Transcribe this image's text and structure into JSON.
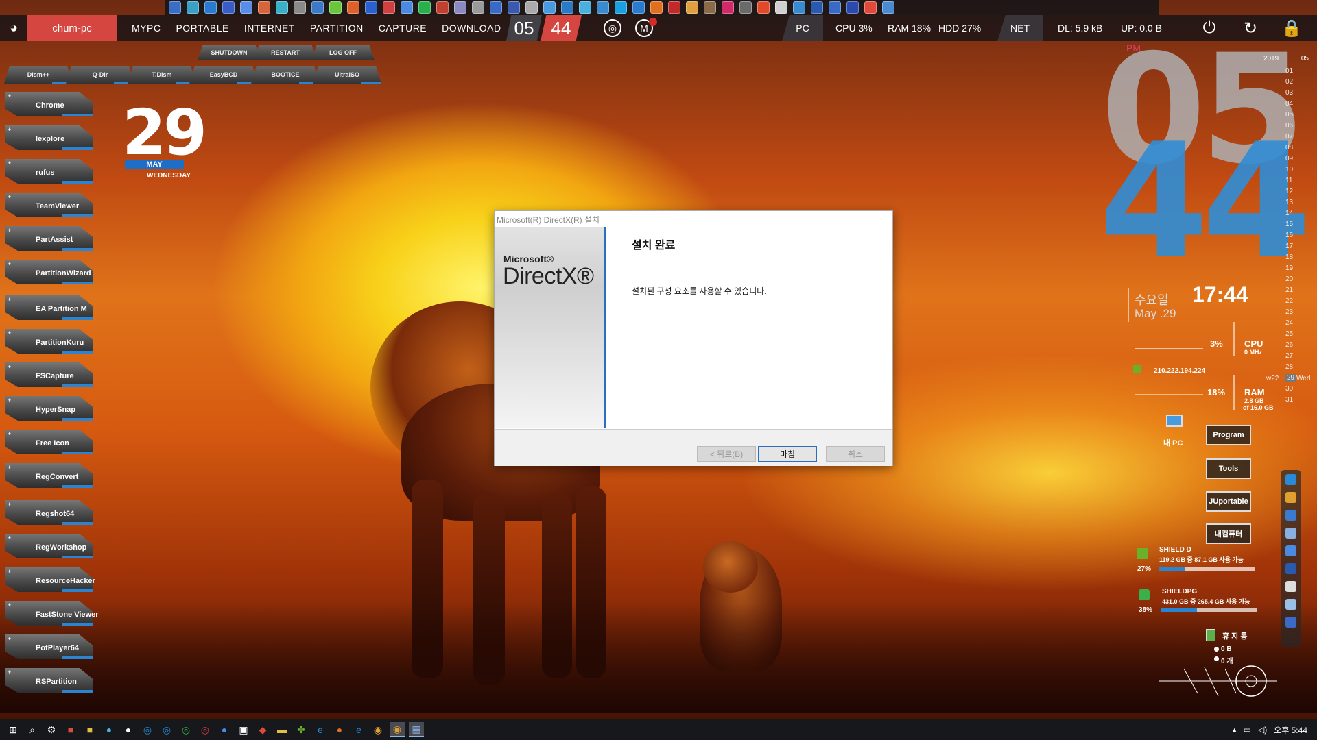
{
  "menubar": {
    "pc_name": "chum-pc",
    "items": [
      "MYPC",
      "PORTABLE",
      "INTERNET",
      "PARTITION",
      "CAPTURE",
      "DOWNLOAD"
    ],
    "clock_hour": "05",
    "clock_minute": "44",
    "pc_label": "PC",
    "cpu": "CPU  3%",
    "ram": "RAM  18%",
    "hdd": "HDD  27%",
    "net_label": "NET",
    "dl": "DL:  5.9 kB",
    "up": "UP:  0.0 B",
    "icons": [
      "power-icon",
      "refresh-icon",
      "lock-icon"
    ]
  },
  "power_tabs": [
    "SHUTDOWN",
    "RESTART",
    "LOG OFF"
  ],
  "tool_tabs": [
    "Dism++",
    "Q-Dir",
    "T.Dism",
    "EasyBCD",
    "BOOTICE",
    "UltraISO"
  ],
  "sidebar": [
    "Chrome",
    "Iexplore",
    "rufus",
    "TeamViewer",
    "PartAssist",
    "PartitionWizard",
    "EA  Partition  M",
    "PartitionKuru",
    "FSCapture",
    "HyperSnap",
    "Free  Icon",
    "RegConvert",
    "Regshot64",
    "RegWorkshop",
    "ResourceHacker",
    "FastStone  Viewer",
    "PotPlayer64",
    "RSPartition"
  ],
  "date_widget": {
    "day": "29",
    "month": "MAY",
    "weekday": "WEDNESDAY"
  },
  "big_clock": {
    "ampm": "PM",
    "hour": "05",
    "minute": "44"
  },
  "clock_info": {
    "korean_weekday": "수요일",
    "date": "May .29",
    "time": "17:44"
  },
  "calendar": {
    "year": "2019",
    "month": "05",
    "days": [
      "01",
      "02",
      "03",
      "04",
      "05",
      "06",
      "07",
      "08",
      "09",
      "10",
      "11",
      "12",
      "13",
      "14",
      "15",
      "16",
      "17",
      "18",
      "19",
      "20",
      "21",
      "22",
      "23",
      "24",
      "25",
      "26",
      "27",
      "28",
      "29",
      "30",
      "31"
    ],
    "selected": "29",
    "week": "w22",
    "weekday": "Wed"
  },
  "stats": {
    "cpu_percent": "3%",
    "cpu_label": "CPU",
    "cpu_mhz": "0 MHz",
    "ip": "210.222.194.224",
    "ram_percent": "18%",
    "ram_label": "RAM",
    "ram_used": "2.8 GB",
    "ram_total": "of 16.0 GB",
    "mypc_label": "내 PC"
  },
  "action_buttons": [
    "Program",
    "Tools",
    "JUportable",
    "내컴퓨터"
  ],
  "drives": [
    {
      "name": "SHIELD D",
      "info": "119.2 GB 중 87.1 GB 사용 가능",
      "percent": "27%",
      "fill": 0.27
    },
    {
      "name": "SHIELDPG",
      "info": "431.0 GB 중 265.4 GB 사용 가능",
      "percent": "38%",
      "fill": 0.38
    }
  ],
  "recycle": {
    "label": "휴 지 통",
    "size": "0 B",
    "count": "0 개"
  },
  "dialog": {
    "title": "Microsoft(R) DirectX(R) 설치",
    "logo_brand": "Microsoft®",
    "logo_product": "DirectX®",
    "heading": "설치 완료",
    "message": "설치된 구성 요소를 사용할 수 있습니다.",
    "back_label": "< 뒤로(B)",
    "finish_label": "마침",
    "cancel_label": "취소"
  },
  "taskbar": {
    "tray_time": "오후 5:44"
  },
  "colors": {
    "accent_red": "#d4463f",
    "accent_blue": "#2a84d2",
    "clock_blue": "#328cd2"
  }
}
